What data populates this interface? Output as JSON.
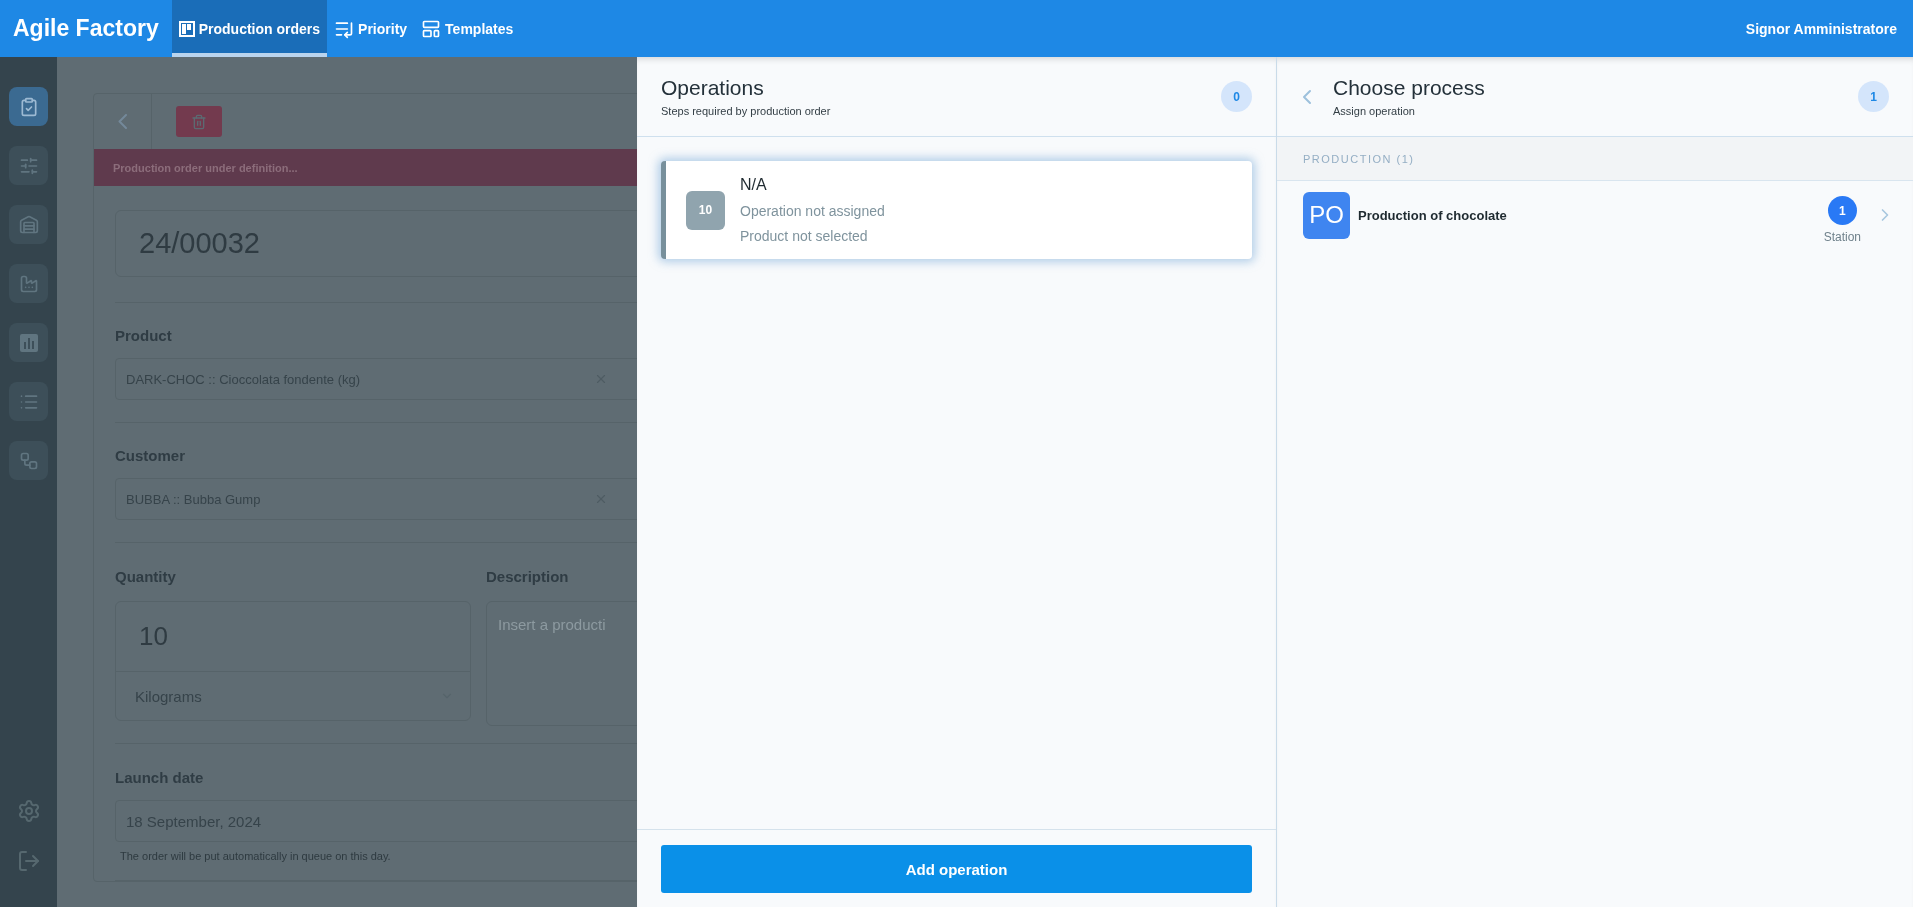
{
  "app": {
    "title": "Agile Factory",
    "user": "Signor Amministratore"
  },
  "nav_tabs": [
    {
      "label": "Production orders",
      "selected": true
    },
    {
      "label": "Priority",
      "selected": false
    },
    {
      "label": "Templates",
      "selected": false
    }
  ],
  "sidebar": {
    "items": [
      {
        "selected": true
      },
      {
        "selected": false
      },
      {
        "selected": false
      },
      {
        "selected": false
      },
      {
        "selected": false
      },
      {
        "selected": false
      },
      {
        "selected": false
      }
    ]
  },
  "order_form": {
    "status_banner": "Production order under definition...",
    "number": "24/00032",
    "product": {
      "label": "Product",
      "value": "DARK-CHOC :: Cioccolata fondente (kg)"
    },
    "customer": {
      "label": "Customer",
      "value": "BUBBA :: Bubba Gump"
    },
    "quantity": {
      "label": "Quantity",
      "value": "10",
      "unit": "Kilograms"
    },
    "description": {
      "label": "Description",
      "placeholder": "Insert a producti"
    },
    "launch_date": {
      "label": "Launch date",
      "value": "18 September, 2024",
      "hint": "The order will be put automatically in queue on this day."
    }
  },
  "operations_panel": {
    "title": "Operations",
    "subtitle": "Steps required by production order",
    "count": "0",
    "operations": [
      {
        "number": "10",
        "name": "N/A",
        "operation": "Operation not assigned",
        "product": "Product not selected",
        "selected": true
      }
    ],
    "add_button": "Add operation"
  },
  "process_panel": {
    "title": "Choose process",
    "subtitle": "Assign operation",
    "count": "1",
    "groups": [
      {
        "title": "PRODUCTION (1)",
        "processes": [
          {
            "initials": "PO",
            "name": "Production of chocolate",
            "stations": "1",
            "stations_label": "Station"
          }
        ]
      }
    ]
  }
}
